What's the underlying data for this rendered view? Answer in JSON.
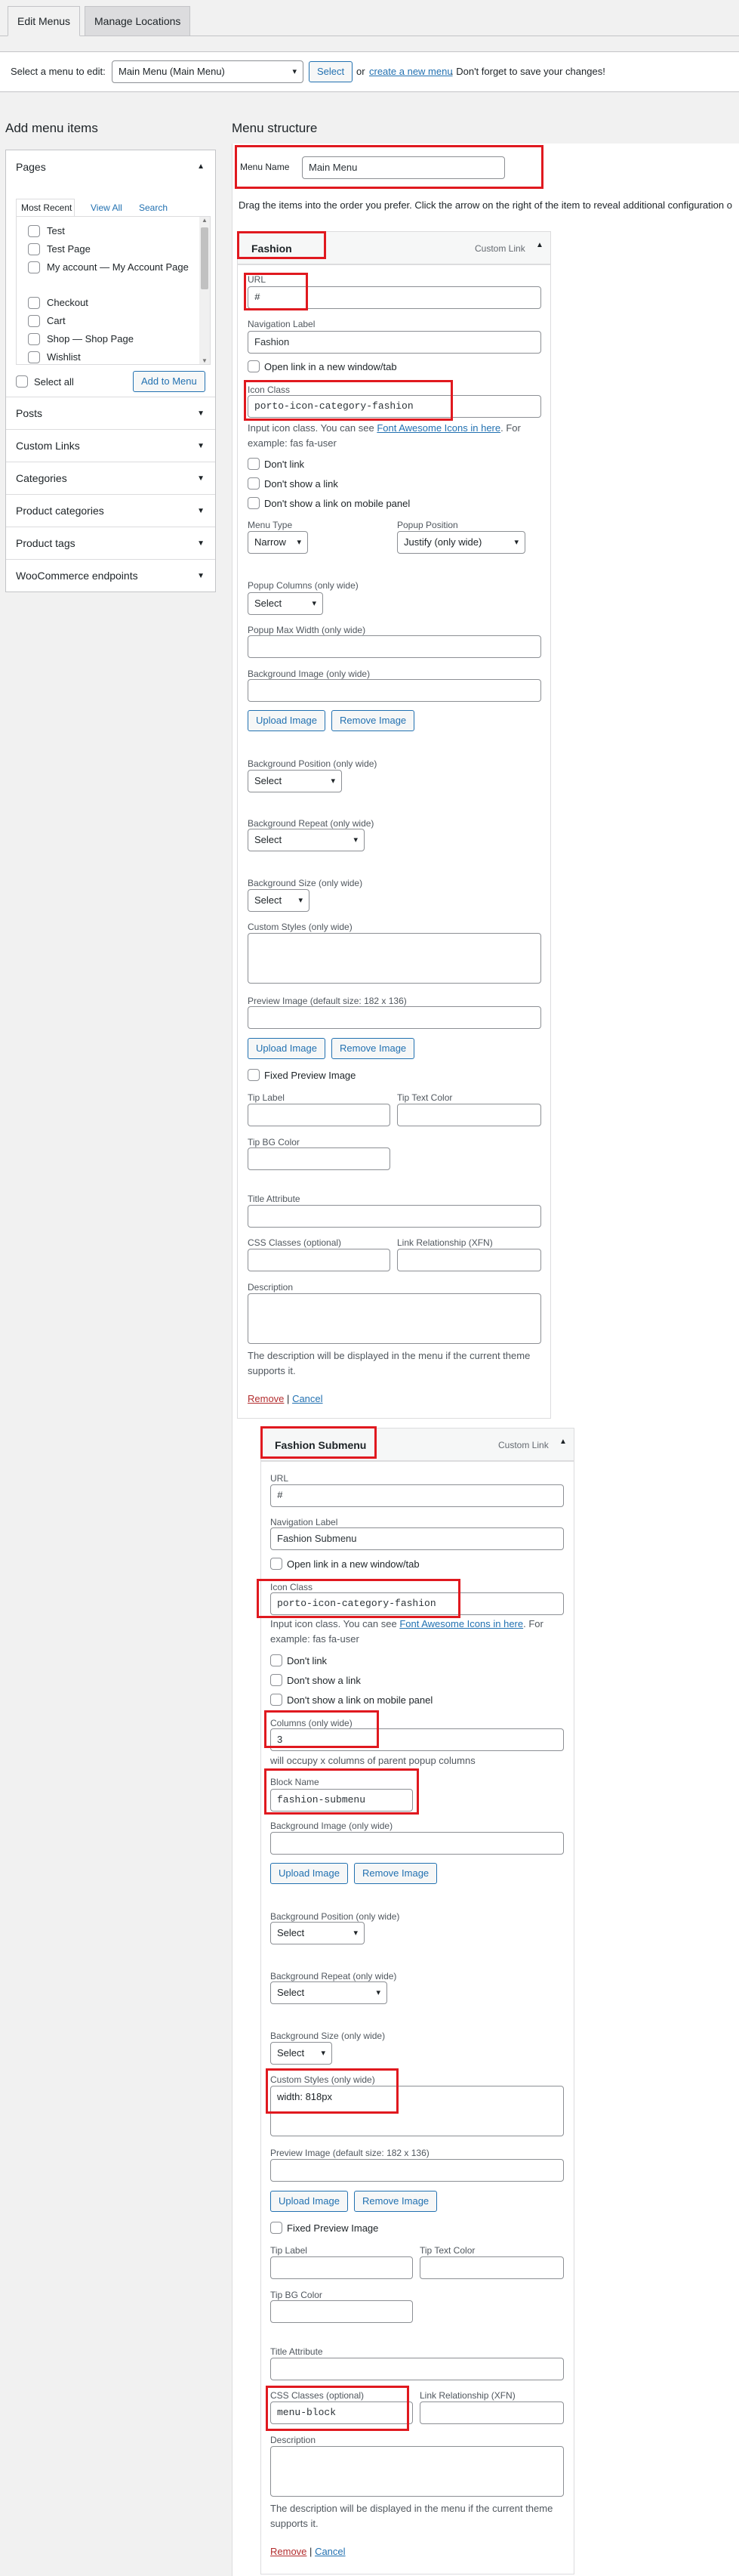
{
  "tabs": {
    "edit": "Edit Menus",
    "manage": "Manage Locations"
  },
  "select_bar": {
    "label": "Select a menu to edit:",
    "selected": "Main Menu (Main Menu)",
    "button": "Select",
    "or": "or",
    "create_link": "create a new menu",
    "suffix": ". Don't forget to save your changes!"
  },
  "sidebar": {
    "title": "Add menu items",
    "pages_title": "Pages",
    "tabs": [
      "Most Recent",
      "View All",
      "Search"
    ],
    "pages": [
      {
        "label": "Test"
      },
      {
        "label": "Test Page"
      },
      {
        "label": "My account — My Account Page"
      },
      {
        "label": "Checkout"
      },
      {
        "label": "Cart"
      },
      {
        "label": "Shop — Shop Page"
      },
      {
        "label": "Wishlist"
      }
    ],
    "select_all": "Select all",
    "add_button": "Add to Menu",
    "sections": [
      "Posts",
      "Custom Links",
      "Categories",
      "Product categories",
      "Product tags",
      "WooCommerce endpoints"
    ]
  },
  "structure": {
    "title": "Menu structure",
    "menu_name_label": "Menu Name",
    "menu_name_value": "Main Menu",
    "instructions": "Drag the items into the order you prefer. Click the arrow on the right of the item to reveal additional configuration o"
  },
  "item1": {
    "title": "Fashion",
    "type": "Custom Link",
    "url_label": "URL",
    "url_value": "#",
    "nav_label": "Navigation Label",
    "nav_value": "Fashion",
    "new_tab": "Open link in a new window/tab",
    "icon_label": "Icon Class",
    "icon_value": "porto-icon-category-fashion",
    "icon_help1": "Input icon class. You can see",
    "icon_help_link": "Font Awesome Icons in here",
    "icon_help2": ". For",
    "icon_help3": "example: fas fa-user",
    "dont_link": "Don't link",
    "dont_show_link": "Don't show a link",
    "dont_show_mobile": "Don't show a link on mobile panel",
    "menu_type_label": "Menu Type",
    "menu_type_value": "Narrow",
    "popup_pos_label": "Popup Position",
    "popup_pos_value": "Justify (only wide)",
    "popup_cols_label": "Popup Columns (only wide)",
    "popup_cols_value": "Select",
    "popup_max_label": "Popup Max Width (only wide)",
    "bg_image_label": "Background Image (only wide)",
    "upload": "Upload Image",
    "remove_image": "Remove Image",
    "bg_pos_label": "Background Position (only wide)",
    "bg_pos_value": "Select",
    "bg_repeat_label": "Background Repeat (only wide)",
    "bg_repeat_value": "Select",
    "bg_size_label": "Background Size (only wide)",
    "bg_size_value": "Select",
    "custom_styles_label": "Custom Styles (only wide)",
    "preview_label": "Preview Image (default size: 182 x 136)",
    "fixed_preview": "Fixed Preview Image",
    "tip_label": "Tip Label",
    "tip_text_color": "Tip Text Color",
    "tip_bg_color": "Tip BG Color",
    "title_attr": "Title Attribute",
    "css_classes": "CSS Classes (optional)",
    "link_rel": "Link Relationship (XFN)",
    "description": "Description",
    "desc_help1": "The description will be displayed in the menu if the current theme",
    "desc_help2": "supports it.",
    "remove": "Remove",
    "sep": "|",
    "cancel": "Cancel"
  },
  "item2": {
    "title": "Fashion Submenu",
    "type": "Custom Link",
    "url_label": "URL",
    "url_value": "#",
    "nav_label": "Navigation Label",
    "nav_value": "Fashion Submenu",
    "new_tab": "Open link in a new window/tab",
    "icon_label": "Icon Class",
    "icon_value": "porto-icon-category-fashion",
    "icon_help1": "Input icon class. You can see",
    "icon_help_link": "Font Awesome Icons in here",
    "icon_help2": ". For",
    "icon_help3": "example: fas fa-user",
    "dont_link": "Don't link",
    "dont_show_link": "Don't show a link",
    "dont_show_mobile": "Don't show a link on mobile panel",
    "columns_label": "Columns (only wide)",
    "columns_value": "3",
    "columns_help": "will occupy x columns of parent popup columns",
    "block_label": "Block Name",
    "block_value": "fashion-submenu",
    "bg_image_label": "Background Image (only wide)",
    "upload": "Upload Image",
    "remove_image": "Remove Image",
    "bg_pos_label": "Background Position (only wide)",
    "bg_pos_value": "Select",
    "bg_repeat_label": "Background Repeat (only wide)",
    "bg_repeat_value": "Select",
    "bg_size_label": "Background Size (only wide)",
    "bg_size_value": "Select",
    "custom_styles_label": "Custom Styles (only wide)",
    "custom_styles_value": "width: 818px",
    "preview_label": "Preview Image (default size: 182 x 136)",
    "fixed_preview": "Fixed Preview Image",
    "tip_label": "Tip Label",
    "tip_text_color": "Tip Text Color",
    "tip_bg_color": "Tip BG Color",
    "title_attr": "Title Attribute",
    "css_classes": "CSS Classes (optional)",
    "css_classes_value": "menu-block",
    "link_rel": "Link Relationship (XFN)",
    "description": "Description",
    "desc_help1": "The description will be displayed in the menu if the current theme",
    "desc_help2": "supports it.",
    "remove": "Remove",
    "sep": "|",
    "cancel": "Cancel"
  },
  "colors": {
    "highlight": "#e0191f",
    "link": "#2271b1",
    "remove": "#b32d2e"
  }
}
